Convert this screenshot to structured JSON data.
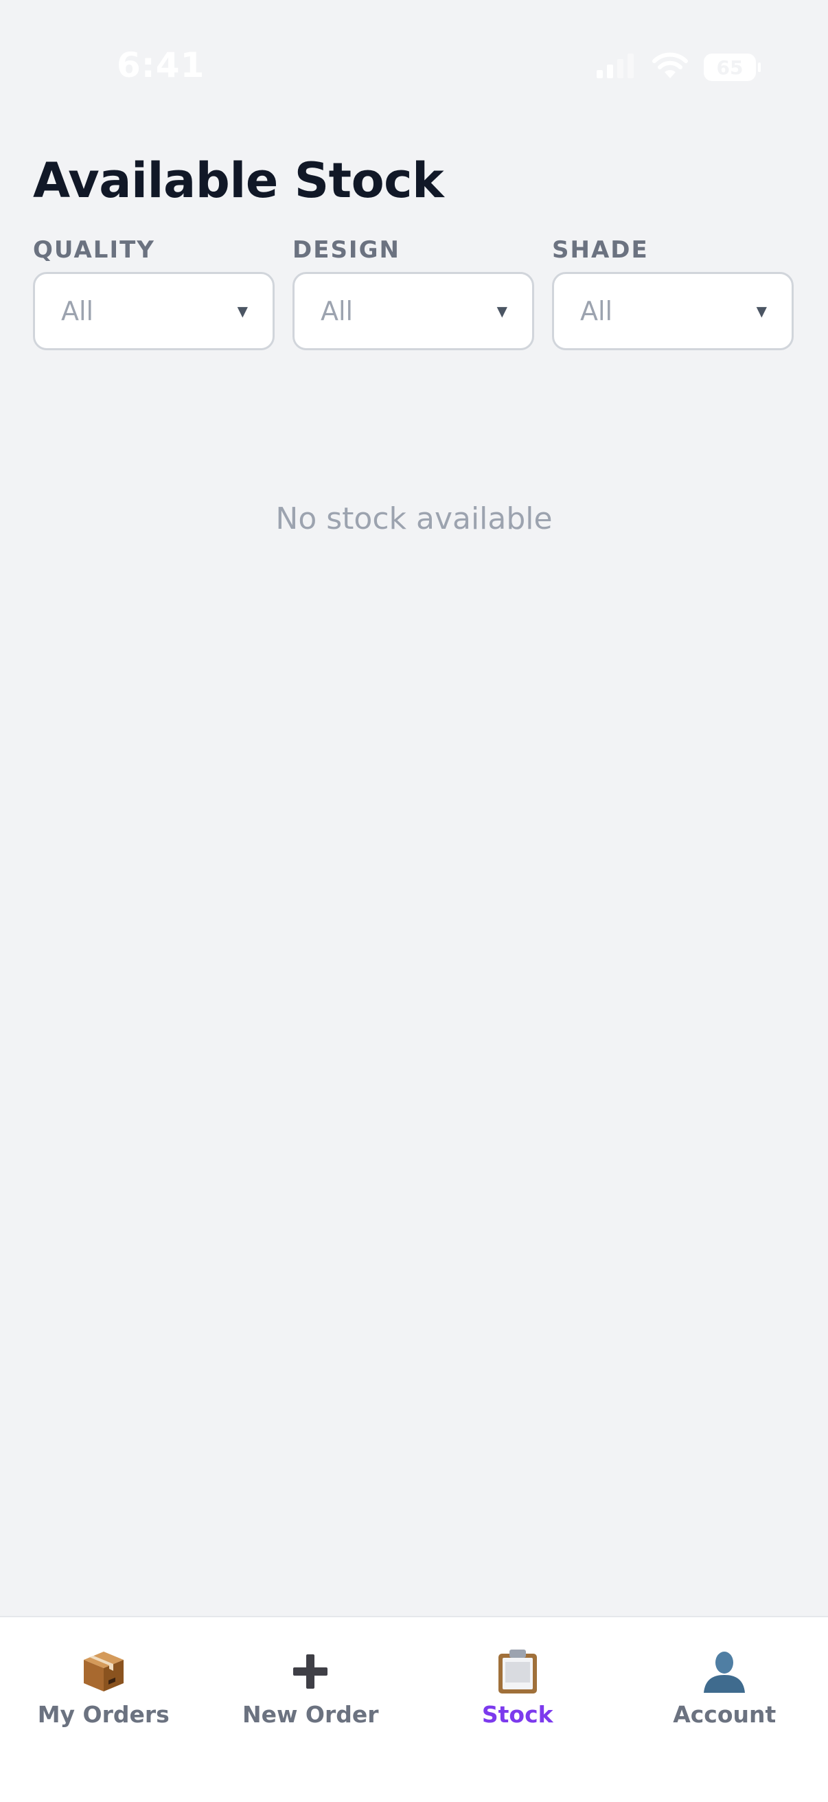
{
  "status_bar": {
    "time": "6:41",
    "battery": "65"
  },
  "header": {
    "title": "Available Stock"
  },
  "filters": [
    {
      "label": "QUALITY",
      "value": "All"
    },
    {
      "label": "DESIGN",
      "value": "All"
    },
    {
      "label": "SHADE",
      "value": "All"
    }
  ],
  "empty_message": "No stock available",
  "tabs": [
    {
      "label": "My Orders",
      "icon": "package-icon",
      "active": false
    },
    {
      "label": "New Order",
      "icon": "plus-icon",
      "active": false
    },
    {
      "label": "Stock",
      "icon": "clipboard-icon",
      "active": true
    },
    {
      "label": "Account",
      "icon": "user-silhouette-icon",
      "active": false
    }
  ],
  "colors": {
    "background": "#f2f3f5",
    "active_tab": "#7c3aed",
    "inactive_tab": "#6b7280",
    "title": "#111827"
  }
}
